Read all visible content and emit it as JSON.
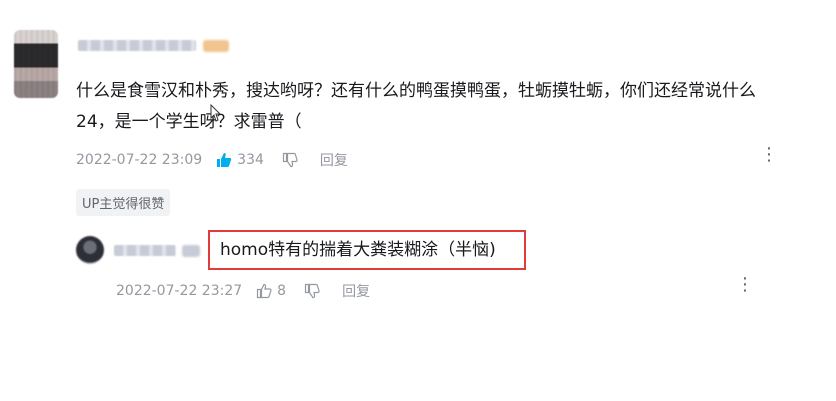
{
  "comment": {
    "text_line1": "什么是食雪汉和朴秀，搜达哟呀？还有什么的鸭蛋摸鸭蛋，牡蛎摸牡蛎，你们还经常说什么",
    "text_line2": "24，是一个学生呀？求雷普（",
    "date": "2022-07-22 23:09",
    "likes": "334",
    "reply_label": "回复",
    "more_glyph": "⋮"
  },
  "up_tag": "UP主觉得很赞",
  "reply": {
    "text": "homo特有的揣着大粪装糊涂（半恼)",
    "date": "2022-07-22 23:27",
    "likes": "8",
    "reply_label": "回复",
    "more_glyph": "⋮"
  },
  "colors": {
    "accent": "#00aeec",
    "highlight_border": "#e23b3b",
    "meta_text": "#9499a0"
  },
  "icons": [
    "thumb-up-icon",
    "thumb-down-icon",
    "more-icon",
    "cursor-icon"
  ]
}
